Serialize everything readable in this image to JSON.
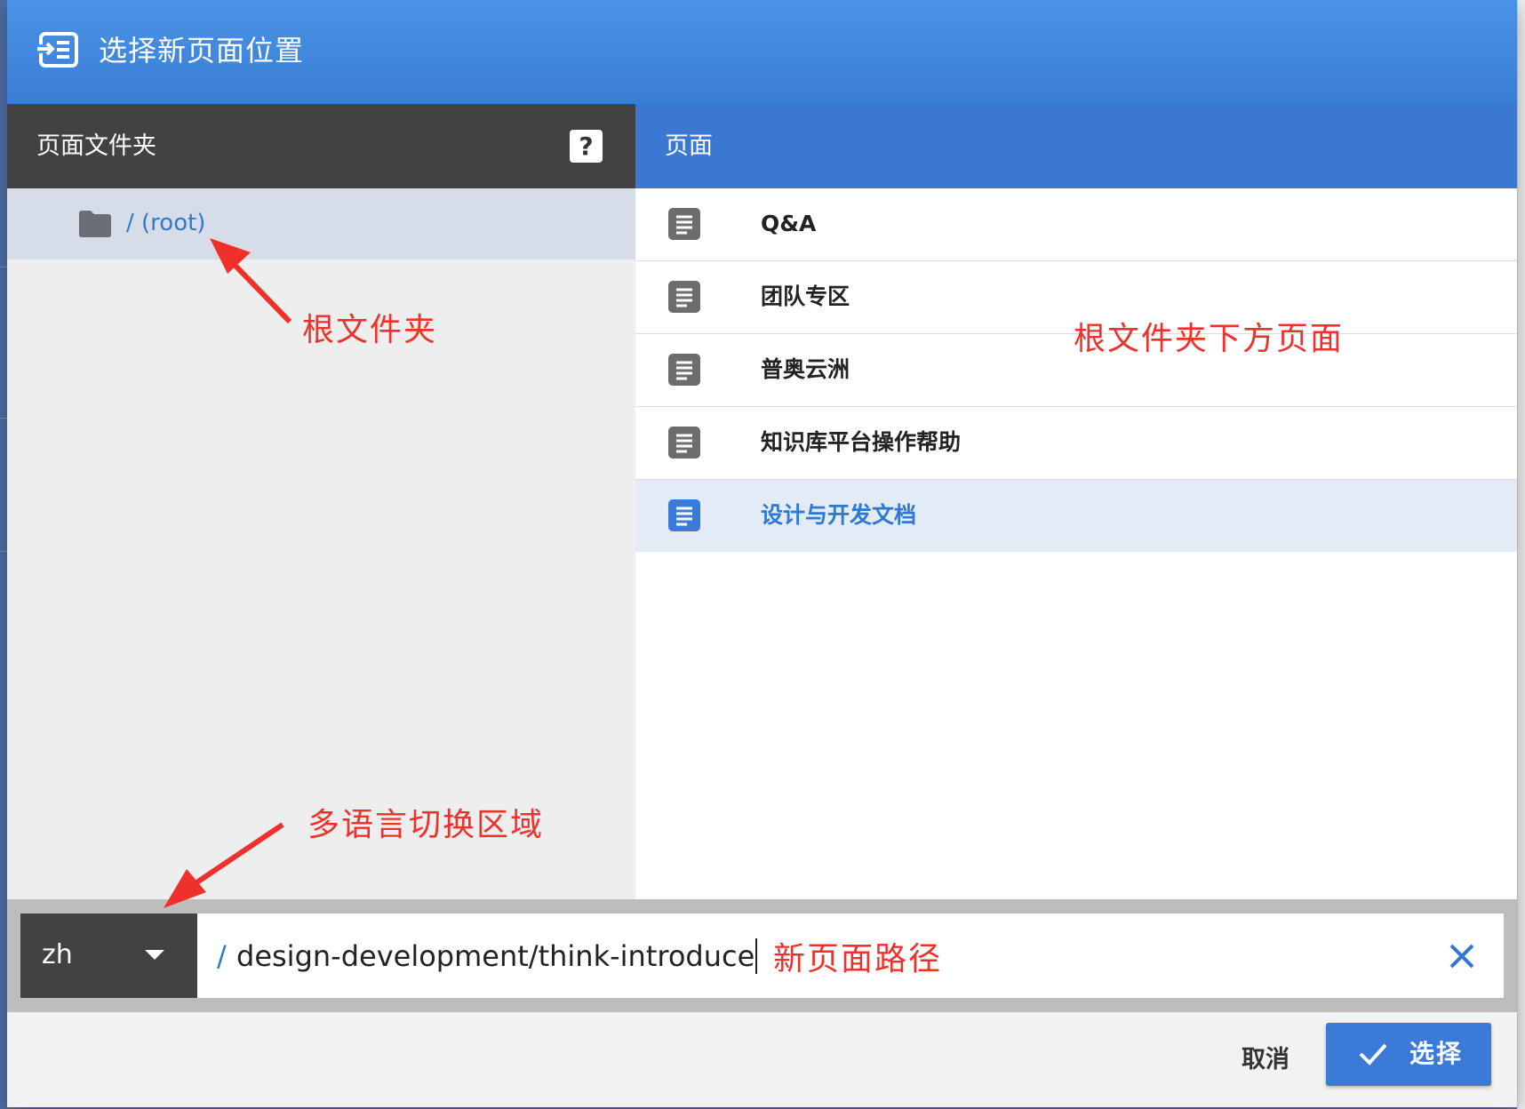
{
  "dialog": {
    "title": "选择新页面位置",
    "title_icon": "move-page-icon"
  },
  "left_panel": {
    "header_label": "页面文件夹",
    "help_label": "?",
    "folders": [
      {
        "label": "/ (root)",
        "icon": "folder-icon",
        "selected": true
      }
    ]
  },
  "right_panel": {
    "header_label": "页面",
    "pages": [
      {
        "label": "Q&A",
        "icon": "document-icon",
        "selected": false
      },
      {
        "label": "团队专区",
        "icon": "document-icon",
        "selected": false
      },
      {
        "label": "普奥云洲",
        "icon": "document-icon",
        "selected": false
      },
      {
        "label": "知识库平台操作帮助",
        "icon": "document-icon",
        "selected": false
      },
      {
        "label": "设计与开发文档",
        "icon": "document-icon",
        "selected": true
      }
    ]
  },
  "path_bar": {
    "locale": "zh",
    "path_prefix": "/",
    "path_value": "design-development/think-introduce"
  },
  "footer": {
    "cancel_label": "取消",
    "select_label": "选择"
  },
  "annotations": {
    "root_folder": "根文件夹",
    "pages_under_root": "根文件夹下方页面",
    "language_switch": "多语言切换区域",
    "new_page_path": "新页面路径"
  },
  "colors": {
    "accent": "#3b78d1",
    "dark_header": "#424242",
    "selected_row": "#e3ebf6",
    "annotation_red": "#f0302a"
  }
}
